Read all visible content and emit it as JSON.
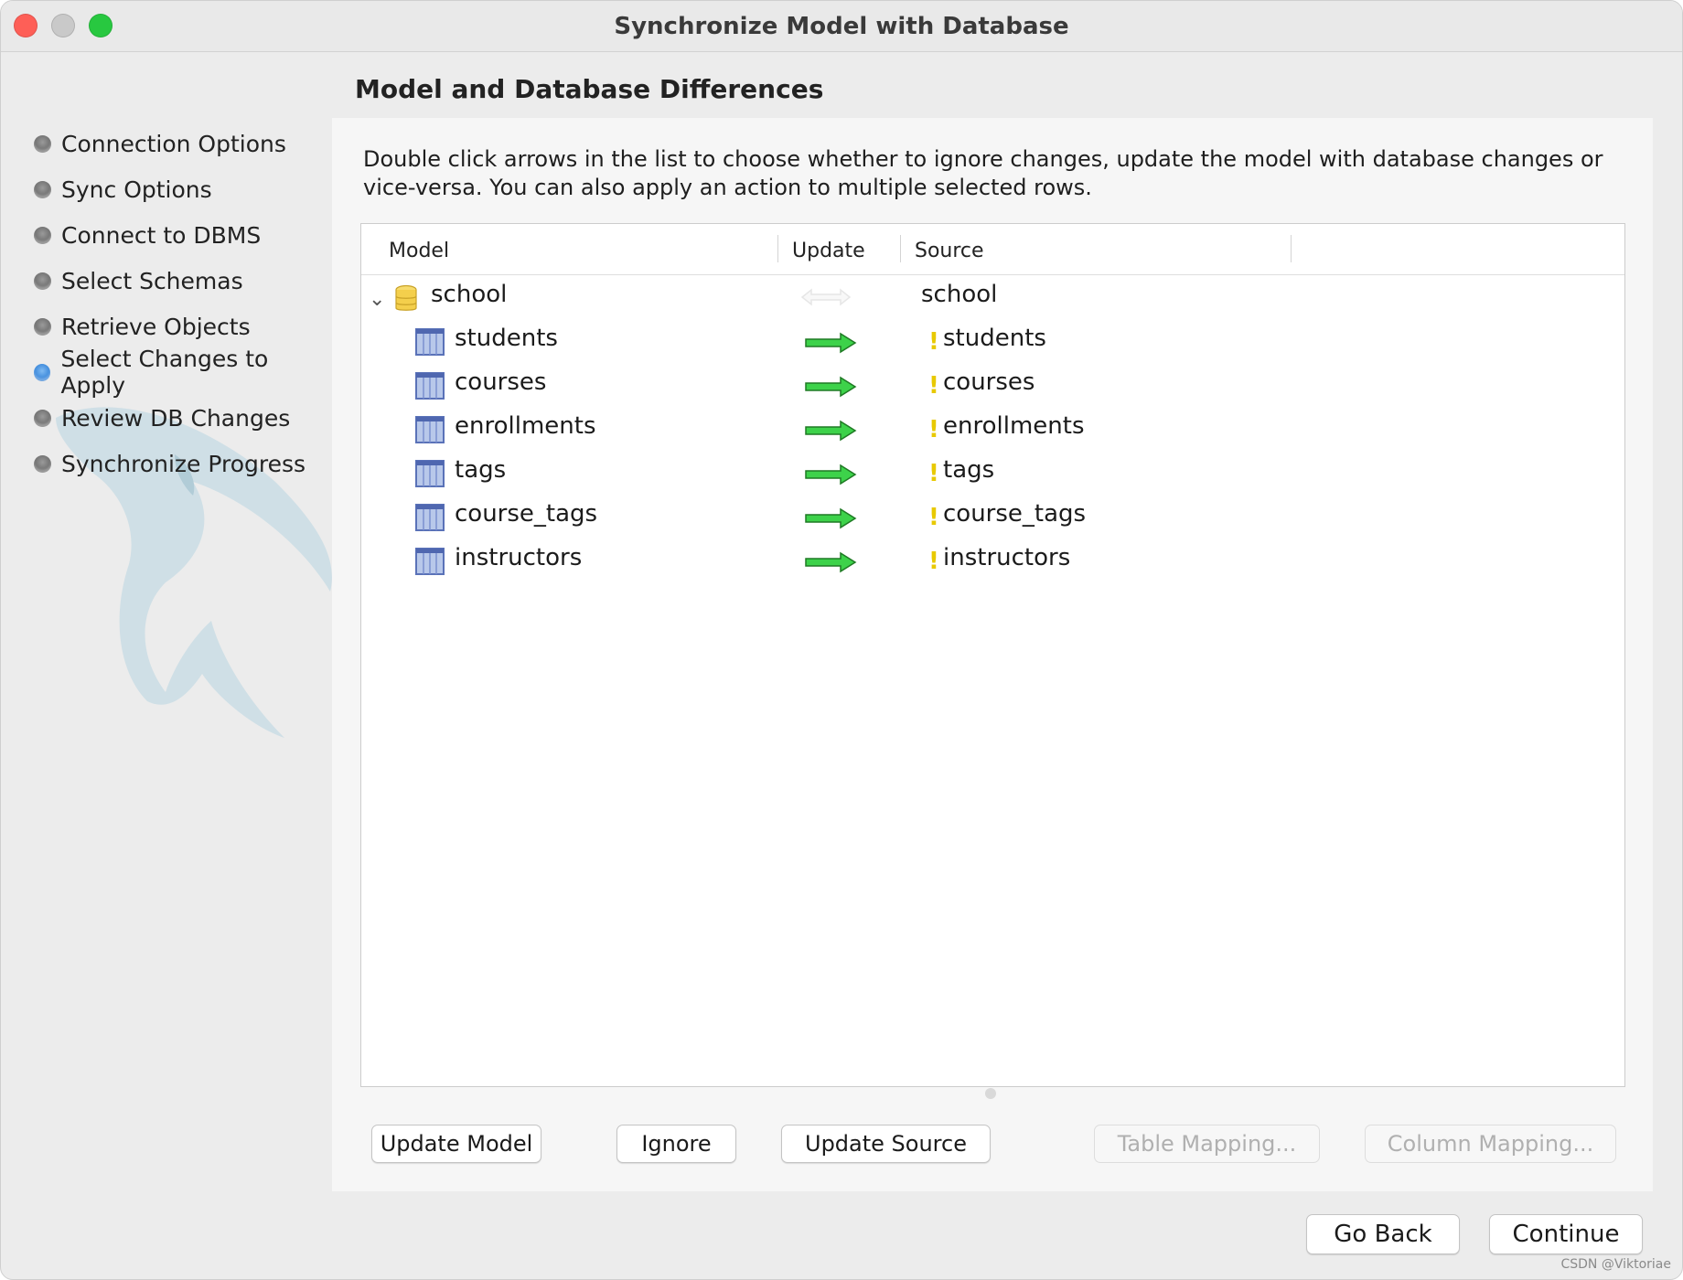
{
  "window": {
    "title": "Synchronize Model with Database"
  },
  "colors": {
    "close": "#fe5f57",
    "minimize": "#c8c8c8",
    "zoom": "#28c840",
    "active_step": "#2f7fd6",
    "arrow": "#3dd24a",
    "warning": "#e8c900"
  },
  "sidebar": {
    "steps": [
      {
        "label": "Connection Options",
        "state": "done"
      },
      {
        "label": "Sync Options",
        "state": "done"
      },
      {
        "label": "Connect to DBMS",
        "state": "done"
      },
      {
        "label": "Select Schemas",
        "state": "done"
      },
      {
        "label": "Retrieve Objects",
        "state": "done"
      },
      {
        "label": "Select Changes to Apply",
        "state": "active"
      },
      {
        "label": "Review DB Changes",
        "state": "pending"
      },
      {
        "label": "Synchronize Progress",
        "state": "pending"
      }
    ]
  },
  "main": {
    "heading": "Model and Database Differences",
    "description": "Double click arrows in the list to choose whether to ignore changes, update the model with database changes or vice-versa. You can also apply an action to multiple selected rows.",
    "columns": {
      "model": "Model",
      "update": "Update",
      "source": "Source"
    },
    "schema": {
      "model": "school",
      "source": "school",
      "icon": "database-icon",
      "direction": "none"
    },
    "tables": [
      {
        "model": "students",
        "source": "students",
        "direction": "to-source"
      },
      {
        "model": "courses",
        "source": "courses",
        "direction": "to-source"
      },
      {
        "model": "enrollments",
        "source": "enrollments",
        "direction": "to-source"
      },
      {
        "model": "tags",
        "source": "tags",
        "direction": "to-source"
      },
      {
        "model": "course_tags",
        "source": "course_tags",
        "direction": "to-source"
      },
      {
        "model": "instructors",
        "source": "instructors",
        "direction": "to-source"
      }
    ],
    "warning_glyph": "!",
    "actions": {
      "update_model": "Update Model",
      "ignore": "Ignore",
      "update_source": "Update Source",
      "table_mapping": "Table Mapping...",
      "column_mapping": "Column Mapping..."
    }
  },
  "footer": {
    "go_back": "Go Back",
    "continue": "Continue",
    "credit": "CSDN @Viktoriae"
  }
}
